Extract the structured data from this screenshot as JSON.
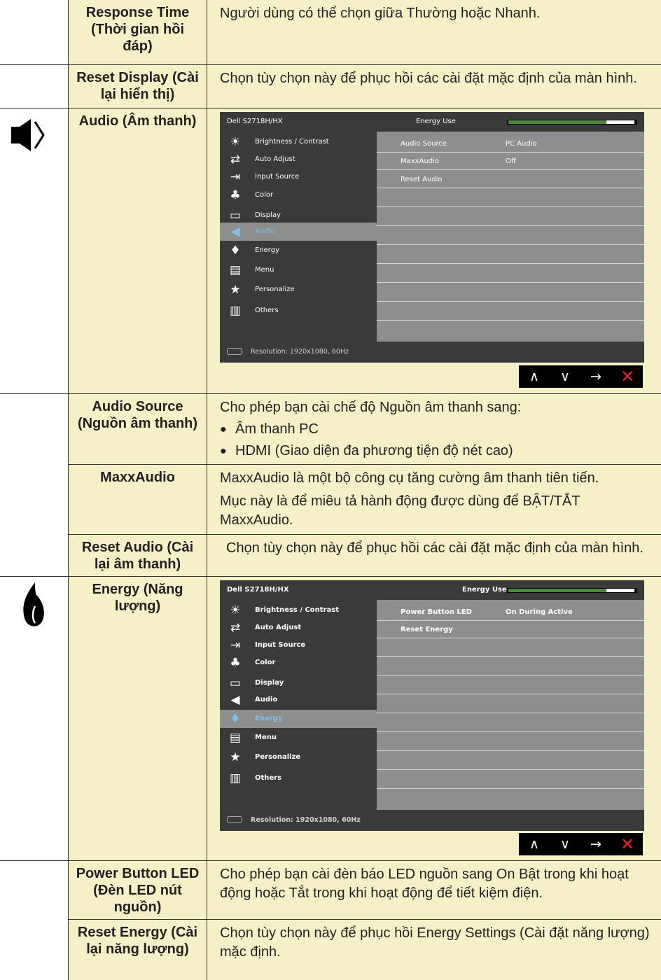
{
  "rows": {
    "response_time": {
      "label": "Response Time (Thời gian hồi đáp)",
      "desc": "Người dùng có thể chọn giữa Thường hoặc Nhanh."
    },
    "reset_display": {
      "label": "Reset Display (Cài lại hiển thị)",
      "desc": "Chọn tùy chọn này để phục hồi các cài đặt mặc định của màn hình."
    },
    "audio": {
      "label": "Audio (Âm thanh)"
    },
    "audio_source": {
      "label": "Audio Source (Nguồn âm thanh)",
      "desc": "Cho phép bạn cài chế độ Nguồn âm thanh sang:",
      "bullets": [
        "Âm thanh PC",
        "HDMI (Giao diện đa phương tiện độ nét cao)"
      ]
    },
    "maxxaudio": {
      "label": "MaxxAudio",
      "desc1": "MaxxAudio là một bộ công cụ tăng cường âm thanh tiên tiến.",
      "desc2": "Mục này là để miêu tả hành động được dùng để BẬT/TẮT MaxxAudio."
    },
    "reset_audio": {
      "label": "Reset Audio (Cài lại âm thanh)",
      "desc": "Chọn tùy chọn này để phục hồi các cài đặt mặc định của màn hình."
    },
    "energy": {
      "label": "Energy (Năng lượng)"
    },
    "power_button_led": {
      "label": "Power Button LED (Đèn LED nút nguồn)",
      "desc": "Cho phép bạn cài đèn báo LED nguồn sang On Bật trong khi hoạt động hoặc Tắt trong khi hoạt động để tiết kiệm điện."
    },
    "reset_energy": {
      "label": "Reset Energy (Cài lại năng lượng)",
      "desc": "Chọn tùy chọn này để phục hồi Energy Settings (Cài đặt năng lượng) mặc định."
    }
  },
  "osd": {
    "model": "Dell S2718H/HX",
    "energy_use": "Energy Use",
    "energy_level": 0.78,
    "resolution": "Resolution: 1920x1080, 60Hz",
    "menu": [
      "Brightness / Contrast",
      "Auto Adjust",
      "Input Source",
      "Color",
      "Display",
      "Audio",
      "Energy",
      "Menu",
      "Personalize",
      "Others"
    ],
    "audio_sub": [
      {
        "name": "Audio Source",
        "value": "PC Audio"
      },
      {
        "name": "MaxxAudio",
        "value": "Off"
      },
      {
        "name": "Reset Audio",
        "value": ""
      }
    ],
    "energy_sub": [
      {
        "name": "Power Button LED",
        "value": "On During Active"
      },
      {
        "name": "Reset Energy",
        "value": ""
      }
    ],
    "nav": {
      "up": "∧",
      "down": "∨",
      "enter": "→",
      "exit": "✕"
    }
  },
  "colors": {
    "cell_bg": "#f5f0c7",
    "osd_dark": "#3a3a3a",
    "osd_gray": "#8d8f8f",
    "highlight": "#7dc1f0",
    "energy_green": "#4b8a3a",
    "exit_red": "#e2231a"
  }
}
